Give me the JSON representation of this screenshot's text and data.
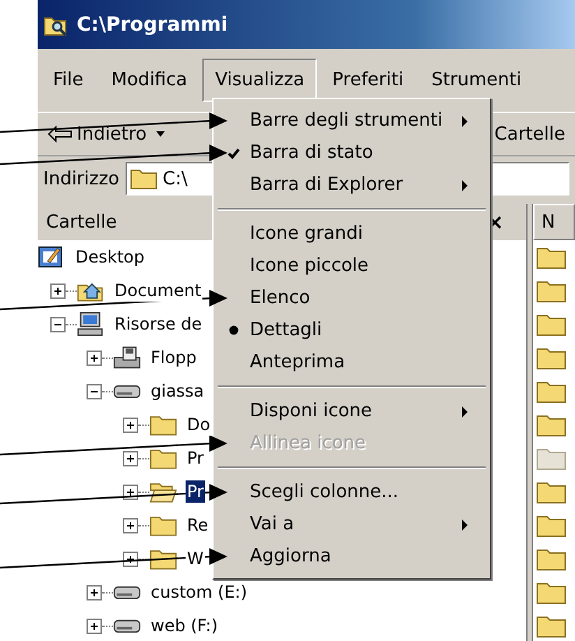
{
  "window": {
    "title": "C:\\Programmi"
  },
  "menubar": [
    {
      "label": "File",
      "selected": false
    },
    {
      "label": "Modifica",
      "selected": false
    },
    {
      "label": "Visualizza",
      "selected": true
    },
    {
      "label": "Preferiti",
      "selected": false
    },
    {
      "label": "Strumenti",
      "selected": false
    }
  ],
  "toolbar": {
    "back": "Indietro",
    "folders": "Cartelle"
  },
  "address": {
    "label": "Indirizzo",
    "value": "C:\\"
  },
  "folders_pane": {
    "title": "Cartelle",
    "close": "×",
    "tree": [
      {
        "label": "Desktop",
        "kind": "desktop",
        "selected": false,
        "children": [
          {
            "label": "Document",
            "kind": "documents",
            "expanded": false,
            "selected": false
          },
          {
            "label": "Risorse de",
            "kind": "computer",
            "expanded": true,
            "selected": false,
            "children": [
              {
                "label": "Flopp",
                "kind": "floppy",
                "expanded": false,
                "selected": false
              },
              {
                "label": "giassa",
                "kind": "drive",
                "expanded": true,
                "selected": false,
                "children": [
                  {
                    "label": "Do",
                    "kind": "folder",
                    "expanded": false,
                    "selected": false
                  },
                  {
                    "label": "Pr",
                    "kind": "folder",
                    "expanded": false,
                    "selected": false
                  },
                  {
                    "label": "Pr",
                    "kind": "folder-open",
                    "expanded": false,
                    "selected": true
                  },
                  {
                    "label": "Re",
                    "kind": "folder",
                    "expanded": false,
                    "selected": false
                  },
                  {
                    "label": "W",
                    "kind": "folder",
                    "expanded": false,
                    "selected": false
                  }
                ]
              },
              {
                "label": "custom (E:)",
                "kind": "drive",
                "expanded": false,
                "selected": false
              },
              {
                "label": "web (F:)",
                "kind": "drive",
                "expanded": false,
                "selected": false
              }
            ]
          }
        ]
      }
    ]
  },
  "file_pane": {
    "header": "N",
    "items": [
      {
        "dimmed": false
      },
      {
        "dimmed": false
      },
      {
        "dimmed": false
      },
      {
        "dimmed": false
      },
      {
        "dimmed": false
      },
      {
        "dimmed": false
      },
      {
        "dimmed": true
      },
      {
        "dimmed": false
      },
      {
        "dimmed": false
      },
      {
        "dimmed": false
      },
      {
        "dimmed": false
      },
      {
        "dimmed": false
      }
    ]
  },
  "menu": [
    {
      "kind": "submenu",
      "label": "Barre degli strumenti",
      "disabled": false,
      "pointed": true
    },
    {
      "kind": "check",
      "label": "Barra di stato",
      "checked": true,
      "disabled": false,
      "pointed": true
    },
    {
      "kind": "submenu",
      "label": "Barra di Explorer",
      "disabled": false,
      "pointed": false
    },
    {
      "kind": "separator"
    },
    {
      "kind": "radio",
      "label": "Icone grandi",
      "selected": false,
      "disabled": false,
      "pointed": false
    },
    {
      "kind": "radio",
      "label": "Icone piccole",
      "selected": false,
      "disabled": false,
      "pointed": false
    },
    {
      "kind": "radio",
      "label": "Elenco",
      "selected": false,
      "disabled": false,
      "pointed": true
    },
    {
      "kind": "radio",
      "label": "Dettagli",
      "selected": true,
      "disabled": false,
      "pointed": false
    },
    {
      "kind": "radio",
      "label": "Anteprima",
      "selected": false,
      "disabled": false,
      "pointed": false
    },
    {
      "kind": "separator"
    },
    {
      "kind": "submenu",
      "label": "Disponi icone",
      "disabled": false,
      "pointed": false
    },
    {
      "kind": "item",
      "label": "Allinea icone",
      "disabled": true,
      "pointed": true
    },
    {
      "kind": "separator"
    },
    {
      "kind": "item",
      "label": "Scegli colonne...",
      "disabled": false,
      "pointed": true
    },
    {
      "kind": "submenu",
      "label": "Vai a",
      "disabled": false,
      "pointed": false
    },
    {
      "kind": "item",
      "label": "Aggiorna",
      "disabled": false,
      "pointed": true
    }
  ]
}
